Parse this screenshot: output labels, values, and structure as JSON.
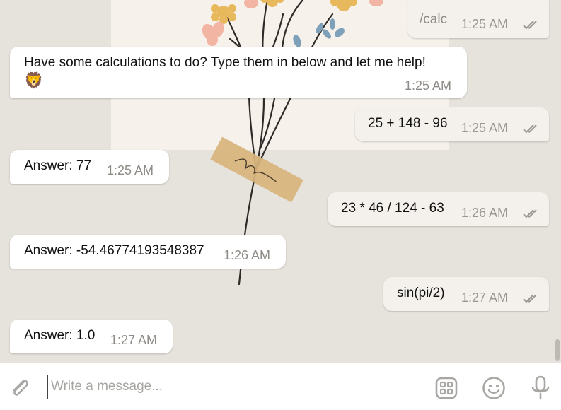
{
  "composer": {
    "placeholder": "Write a message..."
  },
  "messages": [
    {
      "dir": "out",
      "text": "/calc",
      "time": "1:25 AM"
    },
    {
      "dir": "in",
      "text": "Have some calculations to do? Type them in below and let me help!",
      "emoji": "🦁",
      "time": "1:25 AM"
    },
    {
      "dir": "out",
      "text": "25 + 148 - 96",
      "time": "1:25 AM"
    },
    {
      "dir": "in",
      "text": "Answer: 77",
      "time": "1:25 AM"
    },
    {
      "dir": "out",
      "text": "23 * 46 / 124 - 63",
      "time": "1:26 AM"
    },
    {
      "dir": "in",
      "text": "Answer: -54.46774193548387",
      "time": "1:26 AM"
    },
    {
      "dir": "out",
      "text": "sin(pi/2)",
      "time": "1:27 AM"
    },
    {
      "dir": "in",
      "text": "Answer: 1.0",
      "time": "1:27 AM"
    }
  ],
  "colors": {
    "chat_background": "#e6e2dc",
    "incoming_bubble": "#ffffff",
    "outgoing_bubble": "#f4f1ec",
    "read_ticks": "#9a9690"
  },
  "icons": [
    "attach-icon",
    "sticker-panel-icon",
    "emoji-icon",
    "microphone-icon",
    "double-check-icon"
  ]
}
